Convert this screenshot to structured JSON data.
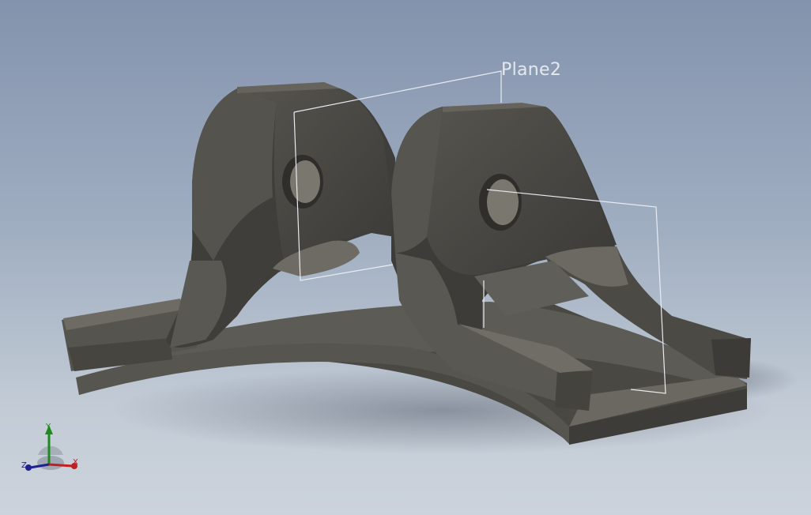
{
  "viewport": {
    "plane_label": "Plane2",
    "model": "bracket-part"
  },
  "triad": {
    "x_label": "X",
    "y_label": "Y",
    "z_label": "Z",
    "colors": {
      "x": "#c02020",
      "y": "#1d8a1d",
      "z": "#20208f"
    }
  },
  "colors": {
    "background_top": "#8393ad",
    "background_bottom": "#ccd3dc",
    "model_dark": "#3e3d3a",
    "model_mid": "#5b5953",
    "model_light": "#7a776f",
    "plane_outline": "#e8ecf1"
  }
}
